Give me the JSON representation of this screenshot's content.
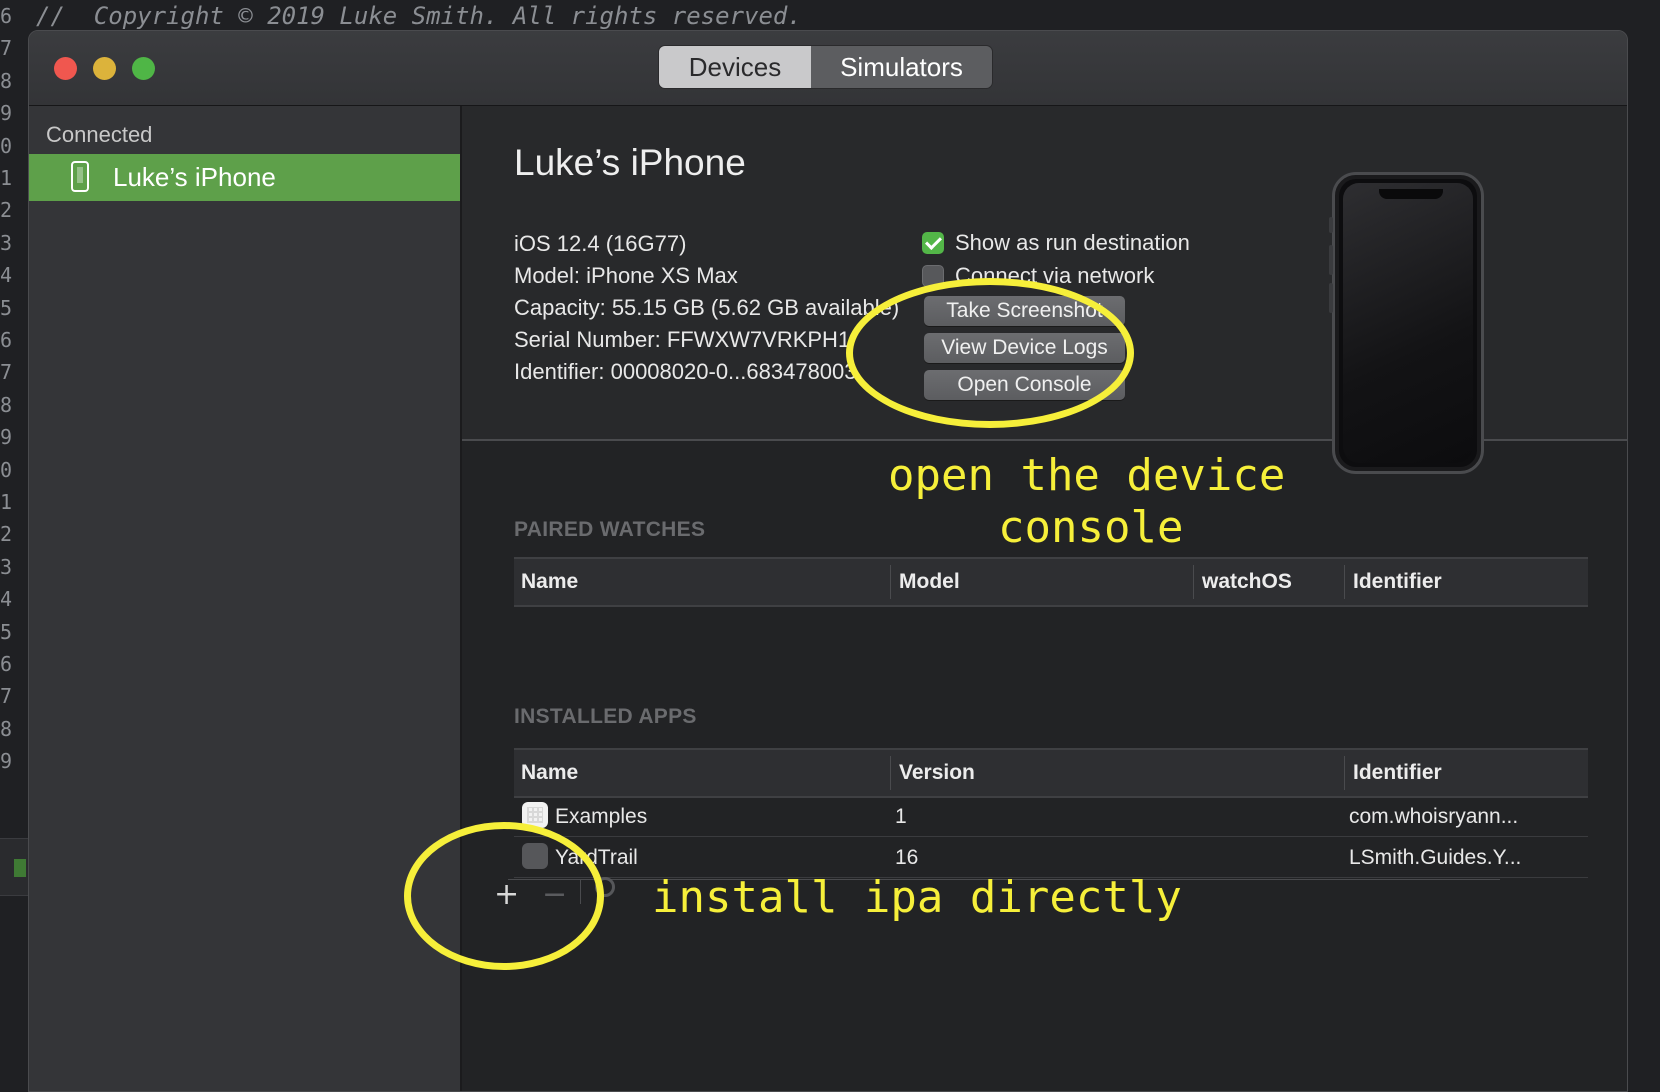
{
  "editor_background": {
    "comment": "//  Copyright © 2019 Luke Smith. All rights reserved.",
    "line_numbers": [
      "6",
      "7",
      "8",
      "9",
      "0",
      "1",
      "2",
      "3",
      "4",
      "5",
      "6",
      "7",
      "8",
      "9",
      "0",
      "1",
      "2",
      "3",
      "4",
      "5",
      "6",
      "7",
      "8",
      "9"
    ]
  },
  "window": {
    "segmented": {
      "devices": "Devices",
      "simulators": "Simulators",
      "selected": "Devices"
    }
  },
  "sidebar": {
    "section": "Connected",
    "items": [
      {
        "label": "Luke’s iPhone",
        "icon": "iphone-icon",
        "selected": true
      }
    ]
  },
  "device": {
    "name": "Luke’s iPhone",
    "ios": "iOS 12.4 (16G77)",
    "model": "Model: iPhone XS Max",
    "capacity": "Capacity: 55.15 GB (5.62 GB available)",
    "serial": "Serial Number: FFWXW7VRKPH1",
    "identifier": "Identifier: 00008020-0...683478003\u0000"
  },
  "options": {
    "show_run_destination": {
      "label": "Show as run destination",
      "checked": true
    },
    "connect_network": {
      "label": "Connect via network",
      "checked": false
    }
  },
  "buttons": {
    "screenshot": "Take Screenshot",
    "device_logs": "View Device Logs",
    "console": "Open Console"
  },
  "paired_watches": {
    "title": "PAIRED WATCHES",
    "columns": [
      "Name",
      "Model",
      "watchOS",
      "Identifier"
    ],
    "rows": []
  },
  "installed_apps": {
    "title": "INSTALLED APPS",
    "columns": [
      "Name",
      "Version",
      "Identifier"
    ],
    "rows": [
      {
        "name": "Examples",
        "version": "1",
        "identifier": "com.whoisryann..."
      },
      {
        "name": "YardTrail",
        "version": "16",
        "identifier": "LSmith.Guides.Y..."
      }
    ]
  },
  "footer": {
    "add": "+",
    "remove": "−"
  },
  "annotations": {
    "console_note_line1": "open the device",
    "console_note_line2": "console",
    "install_note": "install ipa directly",
    "color": "#f6ef3a"
  },
  "colors": {
    "selection": "#5ea04a",
    "checkbox_on": "#53b648",
    "close": "#f0574f",
    "minimize": "#dcb33b",
    "zoom": "#4fb646"
  }
}
